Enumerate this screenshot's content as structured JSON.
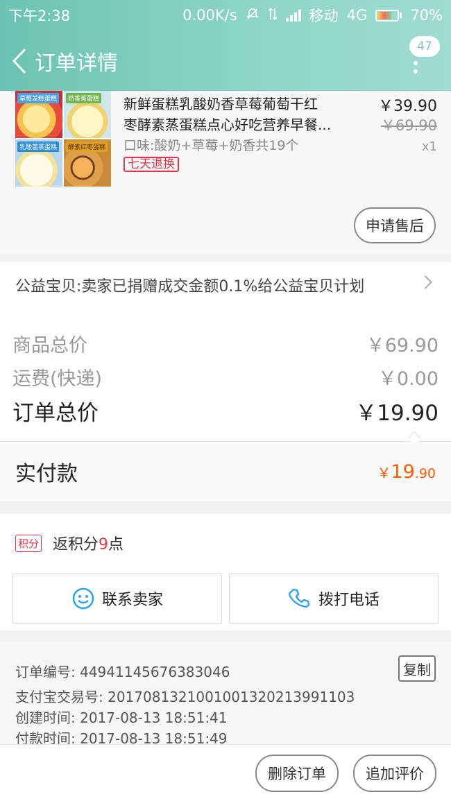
{
  "status_bar": {
    "time": "下午2:38",
    "speed": "0.00K/s",
    "carrier": "移动",
    "network": "4G",
    "battery": "70%"
  },
  "nav": {
    "title": "订单详情",
    "badge_count": "47",
    "icons": [
      "chevron-left-icon",
      "more-vertical-icon"
    ]
  },
  "product": {
    "title_line1": "新鲜蛋糕乳酸奶香草莓葡萄干红",
    "title_line2": "枣酵素蒸蛋糕点心好吃营养早餐...",
    "spec": "口味:酸奶+草莓+奶香共19个",
    "tag": "七天退换",
    "price": "￥39.90",
    "original_price": "￥69.90",
    "quantity": "x1",
    "thumb_labels": [
      "草莓发糕蛋糕",
      "奶香蒸蛋糕",
      "乳酸菌蒸蛋糕",
      "酵素红枣蛋糕"
    ],
    "after_sale_label": "申请售后"
  },
  "charity": {
    "text": "公益宝贝:卖家已捐赠成交金额0.1%给公益宝贝计划"
  },
  "summary": {
    "goods_total_label": "商品总价",
    "goods_total_value": "￥69.90",
    "shipping_label": "运费(快递)",
    "shipping_value": "￥0.00",
    "order_total_label": "订单总价",
    "order_total_value": "￥19.90"
  },
  "paid": {
    "label": "实付款",
    "symbol": "￥",
    "integer": "19",
    "decimal": ".90"
  },
  "points": {
    "badge": "积分",
    "prefix": "返积分",
    "number": "9",
    "suffix": "点"
  },
  "contact": {
    "seller_label": "联系卖家",
    "call_label": "拨打电话"
  },
  "order_info": {
    "order_no": "订单编号: 44941145676383046",
    "copy_label": "复制",
    "alipay_no": "支付宝交易号: 2017081321001001320213991103",
    "created": "创建时间: 2017-08-13 18:51:41",
    "paid_time": "付款时间: 2017-08-13 18:51:49"
  },
  "bottom_bar": {
    "delete_label": "删除订单",
    "review_label": "追加评价"
  },
  "colors": {
    "header_start": "#6cc3b3",
    "accent_orange": "#ff5a00",
    "accent_red": "#e0364c"
  }
}
